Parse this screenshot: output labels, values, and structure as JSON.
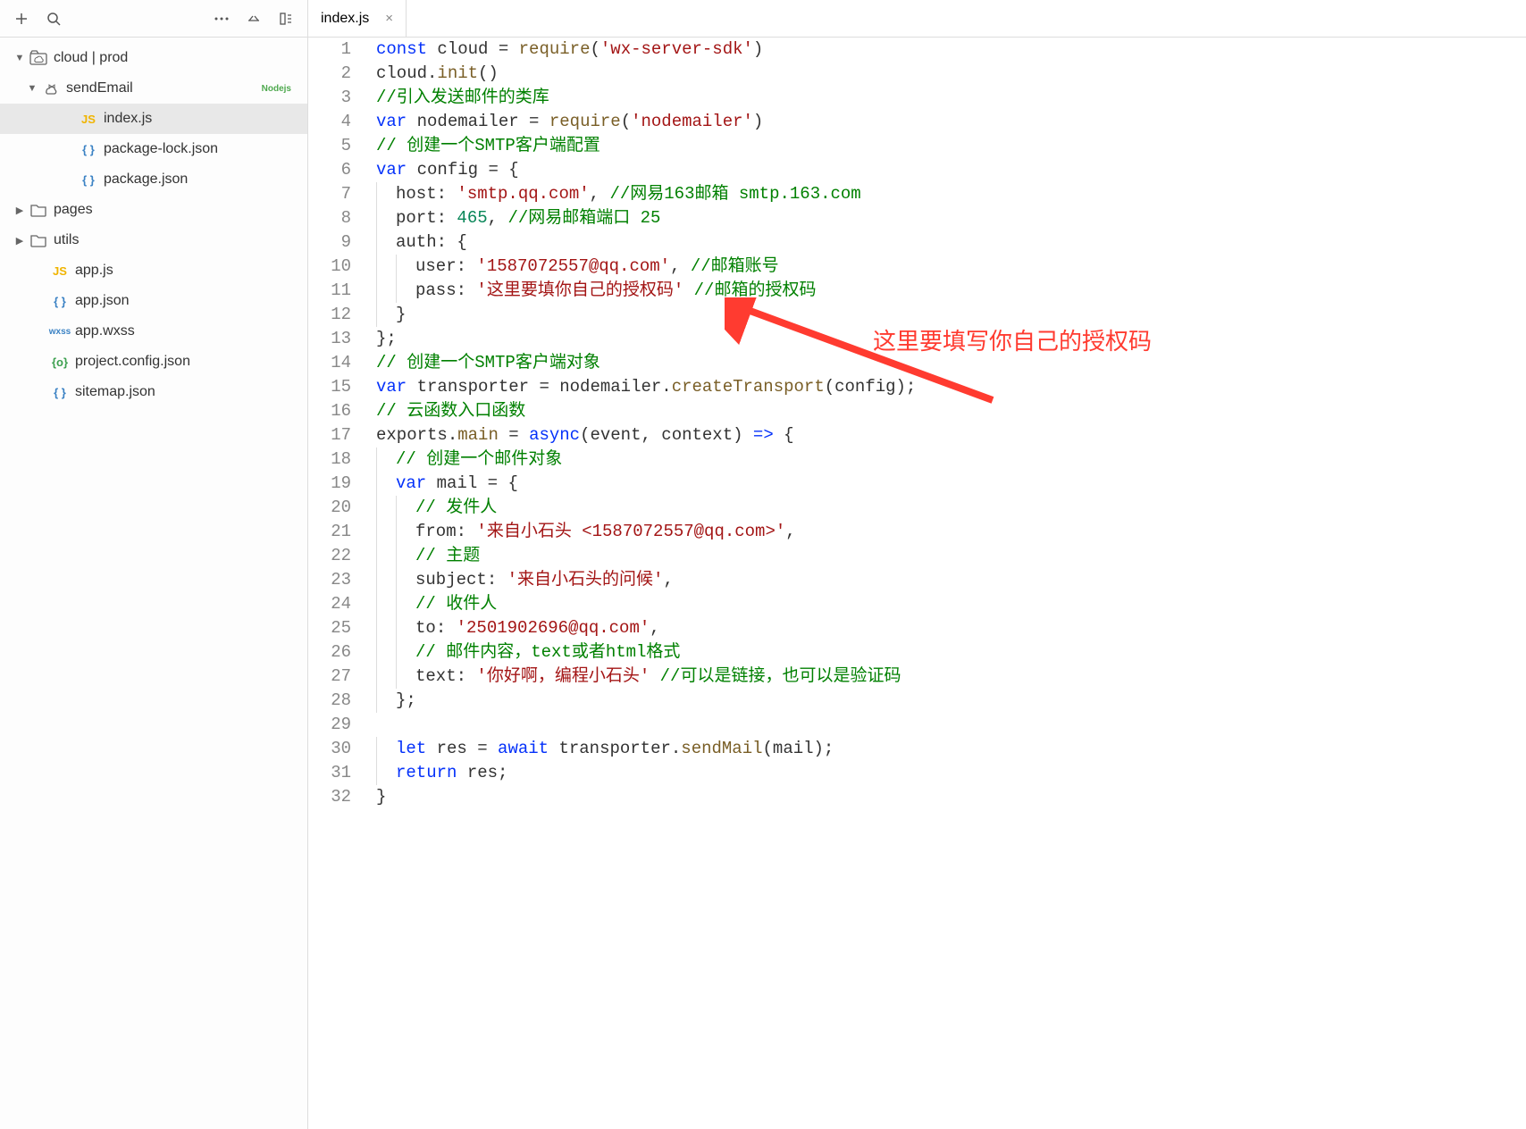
{
  "tab": {
    "name": "index.js"
  },
  "annotation_text": "这里要填写你自己的授权码",
  "sidebar": {
    "items": [
      {
        "indent": 14,
        "toggle": "▼",
        "icon": "cloud-folder",
        "label": "cloud | prod",
        "badge": ""
      },
      {
        "indent": 28,
        "toggle": "▼",
        "icon": "cloud-fn",
        "label": "sendEmail",
        "badge": "Nodejs"
      },
      {
        "indent": 70,
        "toggle": "",
        "icon": "js",
        "label": "index.js",
        "badge": "",
        "selected": true
      },
      {
        "indent": 70,
        "toggle": "",
        "icon": "json-blue",
        "label": "package-lock.json",
        "badge": ""
      },
      {
        "indent": 70,
        "toggle": "",
        "icon": "json-blue",
        "label": "package.json",
        "badge": ""
      },
      {
        "indent": 14,
        "toggle": "▶",
        "icon": "folder",
        "label": "pages",
        "badge": ""
      },
      {
        "indent": 14,
        "toggle": "▶",
        "icon": "folder",
        "label": "utils",
        "badge": ""
      },
      {
        "indent": 38,
        "toggle": "",
        "icon": "js",
        "label": "app.js",
        "badge": ""
      },
      {
        "indent": 38,
        "toggle": "",
        "icon": "json-blue",
        "label": "app.json",
        "badge": ""
      },
      {
        "indent": 38,
        "toggle": "",
        "icon": "wxss",
        "label": "app.wxss",
        "badge": ""
      },
      {
        "indent": 38,
        "toggle": "",
        "icon": "json-green",
        "label": "project.config.json",
        "badge": ""
      },
      {
        "indent": 38,
        "toggle": "",
        "icon": "json-blue",
        "label": "sitemap.json",
        "badge": ""
      }
    ]
  },
  "code": [
    [
      [
        "kw",
        "const"
      ],
      [
        "ident",
        " cloud "
      ],
      [
        "punct",
        "= "
      ],
      [
        "func",
        "require"
      ],
      [
        "punct",
        "("
      ],
      [
        "str",
        "'wx-server-sdk'"
      ],
      [
        "punct",
        ")"
      ]
    ],
    [
      [
        "ident",
        "cloud"
      ],
      [
        "punct",
        "."
      ],
      [
        "func",
        "init"
      ],
      [
        "punct",
        "()"
      ]
    ],
    [
      [
        "comment",
        "//引入发送邮件的类库"
      ]
    ],
    [
      [
        "kw",
        "var"
      ],
      [
        "ident",
        " nodemailer "
      ],
      [
        "punct",
        "= "
      ],
      [
        "func",
        "require"
      ],
      [
        "punct",
        "("
      ],
      [
        "str",
        "'nodemailer'"
      ],
      [
        "punct",
        ")"
      ]
    ],
    [
      [
        "comment",
        "// 创建一个SMTP客户端配置"
      ]
    ],
    [
      [
        "kw",
        "var"
      ],
      [
        "ident",
        " config "
      ],
      [
        "punct",
        "= {"
      ]
    ],
    [
      [
        "indent",
        "  "
      ],
      [
        "prop",
        "host"
      ],
      [
        "punct",
        ": "
      ],
      [
        "str",
        "'smtp.qq.com'"
      ],
      [
        "punct",
        ", "
      ],
      [
        "comment",
        "//网易163邮箱 smtp.163.com"
      ]
    ],
    [
      [
        "indent",
        "  "
      ],
      [
        "prop",
        "port"
      ],
      [
        "punct",
        ": "
      ],
      [
        "num",
        "465"
      ],
      [
        "punct",
        ", "
      ],
      [
        "comment",
        "//网易邮箱端口 25"
      ]
    ],
    [
      [
        "indent",
        "  "
      ],
      [
        "prop",
        "auth"
      ],
      [
        "punct",
        ": {"
      ]
    ],
    [
      [
        "indent",
        "    "
      ],
      [
        "prop",
        "user"
      ],
      [
        "punct",
        ": "
      ],
      [
        "str",
        "'1587072557@qq.com'"
      ],
      [
        "punct",
        ", "
      ],
      [
        "comment",
        "//邮箱账号"
      ]
    ],
    [
      [
        "indent",
        "    "
      ],
      [
        "prop",
        "pass"
      ],
      [
        "punct",
        ": "
      ],
      [
        "str",
        "'这里要填你自己的授权码'"
      ],
      [
        "ident",
        " "
      ],
      [
        "comment",
        "//邮箱的授权码"
      ]
    ],
    [
      [
        "indent",
        "  "
      ],
      [
        "punct",
        "}"
      ]
    ],
    [
      [
        "punct",
        "};"
      ]
    ],
    [
      [
        "comment",
        "// 创建一个SMTP客户端对象"
      ]
    ],
    [
      [
        "kw",
        "var"
      ],
      [
        "ident",
        " transporter "
      ],
      [
        "punct",
        "= nodemailer."
      ],
      [
        "func",
        "createTransport"
      ],
      [
        "punct",
        "(config);"
      ]
    ],
    [
      [
        "comment",
        "// 云函数入口函数"
      ]
    ],
    [
      [
        "ident",
        "exports"
      ],
      [
        "punct",
        "."
      ],
      [
        "func",
        "main"
      ],
      [
        "punct",
        " = "
      ],
      [
        "kw",
        "async"
      ],
      [
        "punct",
        "(event, context) "
      ],
      [
        "kw",
        "=>"
      ],
      [
        "punct",
        " {"
      ]
    ],
    [
      [
        "indent",
        "  "
      ],
      [
        "comment",
        "// 创建一个邮件对象"
      ]
    ],
    [
      [
        "indent",
        "  "
      ],
      [
        "kw",
        "var"
      ],
      [
        "ident",
        " mail "
      ],
      [
        "punct",
        "= {"
      ]
    ],
    [
      [
        "indent",
        "    "
      ],
      [
        "comment",
        "// 发件人"
      ]
    ],
    [
      [
        "indent",
        "    "
      ],
      [
        "prop",
        "from"
      ],
      [
        "punct",
        ": "
      ],
      [
        "str",
        "'来自小石头 <1587072557@qq.com>'"
      ],
      [
        "punct",
        ","
      ]
    ],
    [
      [
        "indent",
        "    "
      ],
      [
        "comment",
        "// 主题"
      ]
    ],
    [
      [
        "indent",
        "    "
      ],
      [
        "prop",
        "subject"
      ],
      [
        "punct",
        ": "
      ],
      [
        "str",
        "'来自小石头的问候'"
      ],
      [
        "punct",
        ","
      ]
    ],
    [
      [
        "indent",
        "    "
      ],
      [
        "comment",
        "// 收件人"
      ]
    ],
    [
      [
        "indent",
        "    "
      ],
      [
        "prop",
        "to"
      ],
      [
        "punct",
        ": "
      ],
      [
        "str",
        "'2501902696@qq.com'"
      ],
      [
        "punct",
        ","
      ]
    ],
    [
      [
        "indent",
        "    "
      ],
      [
        "comment",
        "// 邮件内容，text或者html格式"
      ]
    ],
    [
      [
        "indent",
        "    "
      ],
      [
        "prop",
        "text"
      ],
      [
        "punct",
        ": "
      ],
      [
        "str",
        "'你好啊，编程小石头'"
      ],
      [
        "ident",
        " "
      ],
      [
        "comment",
        "//可以是链接，也可以是验证码"
      ]
    ],
    [
      [
        "indent",
        "  "
      ],
      [
        "punct",
        "};"
      ]
    ],
    [],
    [
      [
        "indent",
        "  "
      ],
      [
        "kw",
        "let"
      ],
      [
        "ident",
        " res "
      ],
      [
        "punct",
        "= "
      ],
      [
        "kw",
        "await"
      ],
      [
        "ident",
        " transporter"
      ],
      [
        "punct",
        "."
      ],
      [
        "func",
        "sendMail"
      ],
      [
        "punct",
        "(mail);"
      ]
    ],
    [
      [
        "indent",
        "  "
      ],
      [
        "kw",
        "return"
      ],
      [
        "ident",
        " res"
      ],
      [
        "punct",
        ";"
      ]
    ],
    [
      [
        "punct",
        "}"
      ]
    ]
  ]
}
